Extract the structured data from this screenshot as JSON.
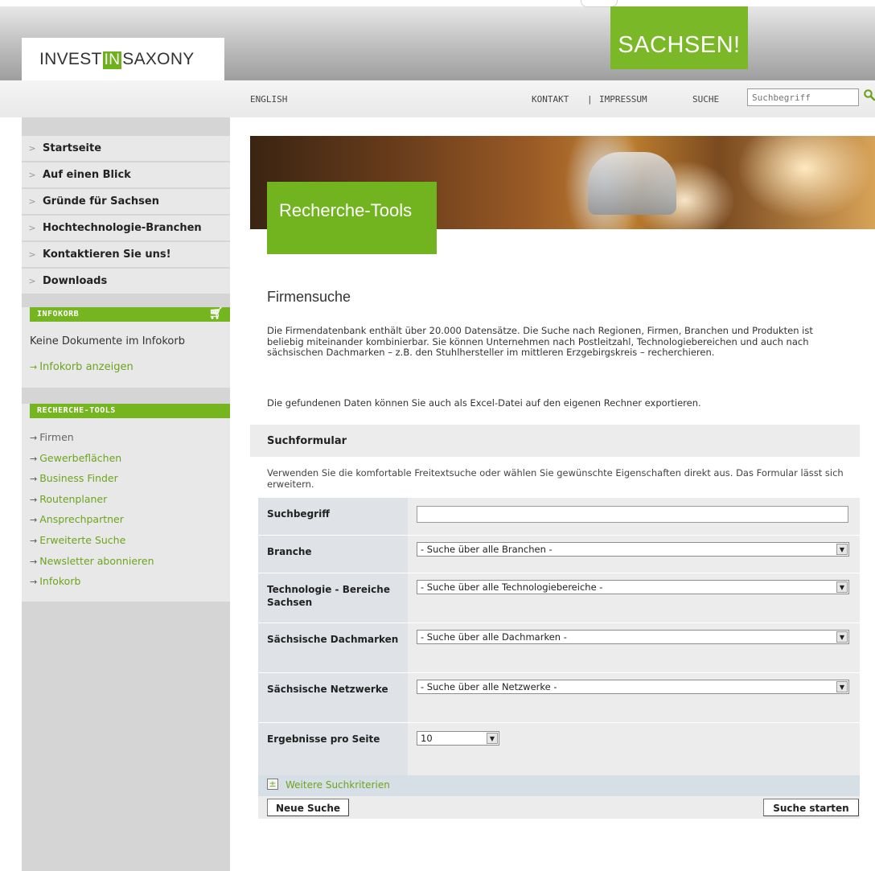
{
  "header": {
    "logo": {
      "left": "INVEST",
      "middle": "IN",
      "right": "SAXONY"
    },
    "badge": "SACHSEN!",
    "colors": {
      "accent": "#74b520",
      "link": "#6ca51d"
    }
  },
  "utility": {
    "language": "ENGLISH",
    "contact": "KONTAKT",
    "separator": "|",
    "imprint": "IMPRESSUM",
    "search_label": "SUCHE",
    "search_placeholder": "Suchbegriff",
    "search_icon": "search-icon"
  },
  "sidebar": {
    "nav": [
      {
        "label": "Startseite"
      },
      {
        "label": "Auf einen Blick"
      },
      {
        "label": "Gründe für Sachsen"
      },
      {
        "label": "Hochtechnologie-Branchen"
      },
      {
        "label": "Kontaktieren Sie uns!"
      },
      {
        "label": "Downloads"
      }
    ],
    "infokorb": {
      "title": "INFOKORB",
      "icon": "cart-icon",
      "empty_text": "Keine Dokumente im Infokorb",
      "show_link": "Infokorb anzeigen"
    },
    "tools": {
      "title": "RECHERCHE-TOOLS",
      "items": [
        {
          "label": "Firmen",
          "active": true
        },
        {
          "label": "Gewerbeflächen"
        },
        {
          "label": "Business Finder"
        },
        {
          "label": "Routenplaner"
        },
        {
          "label": "Ansprechpartner"
        },
        {
          "label": "Erweiterte Suche"
        },
        {
          "label": "Newsletter abonnieren"
        },
        {
          "label": "Infokorb"
        }
      ]
    }
  },
  "hero": {
    "title": "Recherche-Tools"
  },
  "content": {
    "title": "Firmensuche",
    "intro": "Die Firmendatenbank enthält über 20.000 Datensätze. Die Suche nach Regionen, Firmen, Branchen und Produkten ist beliebig miteinander kombinierbar. Sie können Unternehmen nach Postleitzahl, Technologiebereichen und auch nach sächsischen Dachmarken – z.B. den Stuhlhersteller im mittleren Erzgebirgskreis – recherchieren.",
    "export_note": "Die gefundenen Daten können Sie auch als Excel-Datei auf den eigenen Rechner exportieren."
  },
  "form": {
    "title": "Suchformular",
    "description": "Verwenden Sie die komfortable Freitextsuche oder wählen Sie gewünschte Eigenschaften direkt aus. Das Formular lässt sich erweitern.",
    "fields": {
      "keyword": {
        "label": "Suchbegriff",
        "value": ""
      },
      "branch": {
        "label": "Branche",
        "value": "- Suche über alle Branchen -"
      },
      "technology": {
        "label": "Technologie - Bereiche Sachsen",
        "value": "- Suche über alle Technologiebereiche -"
      },
      "brands": {
        "label": "Sächsische Dachmarken",
        "value": "- Suche über alle Dachmarken -"
      },
      "networks": {
        "label": "Sächsische Netzwerke",
        "value": "- Suche über alle Netzwerke -"
      },
      "per_page": {
        "label": "Ergebnisse pro Seite",
        "value": "10"
      }
    },
    "more_criteria": "Weitere Suchkriterien",
    "reset_button": "Neue Suche",
    "submit_button": "Suche starten"
  }
}
